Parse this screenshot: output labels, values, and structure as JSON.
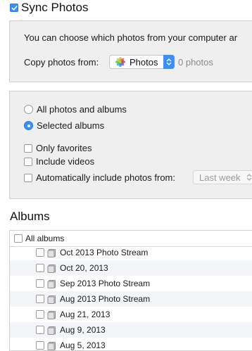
{
  "header": {
    "title": "Sync Photos",
    "checked": true
  },
  "intro": {
    "text": "You can choose which photos from your computer ar"
  },
  "copy_from": {
    "label": "Copy photos from:",
    "source": "Photos",
    "count": "0 photos"
  },
  "scope": {
    "all": "All photos and albums",
    "selected": "Selected albums",
    "selected_value": "selected"
  },
  "options": {
    "favorites": "Only favorites",
    "videos": "Include videos",
    "auto": "Automatically include photos from:",
    "auto_value": "Last week"
  },
  "albums": {
    "title": "Albums",
    "all_label": "All albums",
    "items": [
      {
        "label": "Oct 2013 Photo Stream"
      },
      {
        "label": "Oct 20, 2013"
      },
      {
        "label": "Sep 2013 Photo Stream"
      },
      {
        "label": "Aug 2013 Photo Stream"
      },
      {
        "label": "Aug 21, 2013"
      },
      {
        "label": "Aug 9, 2013"
      },
      {
        "label": "Aug 5, 2013"
      }
    ]
  },
  "colors": {
    "accent": "#3b8ff6",
    "panel": "#efefef",
    "border": "#cfcfcf"
  }
}
